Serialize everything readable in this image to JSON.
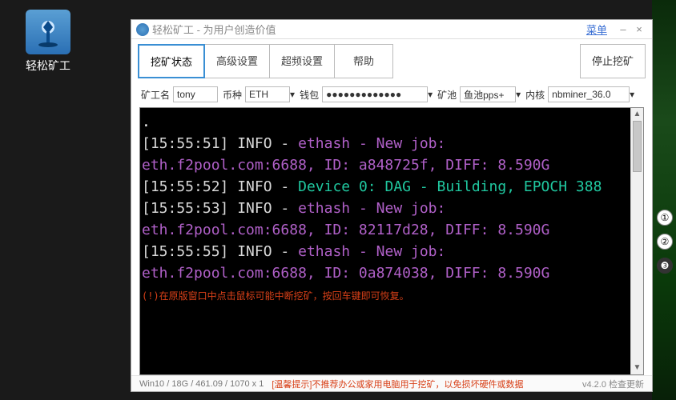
{
  "desktop": {
    "label": "轻松矿工"
  },
  "window": {
    "title": "轻松矿工 - 为用户创造价值",
    "menu": "菜单",
    "minimize": "–",
    "close": "×"
  },
  "tabs": {
    "mining_status": "挖矿状态",
    "advanced": "高级设置",
    "overclock": "超频设置",
    "help": "帮助",
    "stop_mining": "停止挖矿"
  },
  "fields": {
    "miner_label": "矿工名",
    "miner_value": "tony",
    "coin_label": "币种",
    "coin_value": "ETH",
    "wallet_label": "钱包",
    "wallet_value": "●●●●●●●●●●●●●",
    "pool_label": "矿池",
    "pool_value": "鱼池pps+",
    "kernel_label": "内核",
    "kernel_value": "nbminer_36.0"
  },
  "console": {
    "lines": [
      {
        "ts": "[15:55:51]",
        "lvl": "INFO",
        "kind": "job",
        "t1": "ethash - New job: eth.f2pool.com:6688, ID: a848725f, DIFF: 8.590G"
      },
      {
        "ts": "[15:55:52]",
        "lvl": "INFO",
        "kind": "dev",
        "t1": "Device 0: DAG - Building, EPOCH 388"
      },
      {
        "ts": "[15:55:53]",
        "lvl": "INFO",
        "kind": "job",
        "t1": "ethash - New job: eth.f2pool.com:6688, ID: 82117d28, DIFF: 8.590G"
      },
      {
        "ts": "[15:55:55]",
        "lvl": "INFO",
        "kind": "job",
        "t1": "ethash - New job: eth.f2pool.com:6688, ID: 0a874038, DIFF: 8.590G"
      }
    ],
    "warn": "(!)在原版窗口中点击鼠标可能中断挖矿，按回车键即可恢复。"
  },
  "status": {
    "sys": "Win10  /  18G / 461.09  /  1070 x 1",
    "tip": "[温馨提示]不推荐办公或家用电脑用于挖矿，以免损坏硬件或数据",
    "version": "v4.2.0 检查更新"
  },
  "badges": {
    "b1": "①",
    "b2": "②",
    "b3": "❸"
  }
}
